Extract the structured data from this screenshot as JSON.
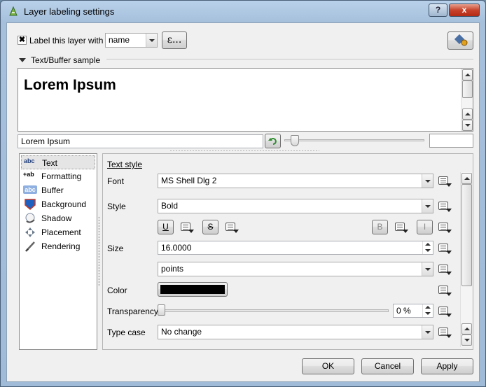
{
  "window": {
    "title": "Layer labeling settings",
    "help": "?",
    "close": "x"
  },
  "top": {
    "label_checkbox": "Label this layer with",
    "checked": "✖",
    "field_value": "name",
    "expr_button": "ε..."
  },
  "sample": {
    "header": "Text/Buffer sample",
    "preview_text": "Lorem Ipsum",
    "input_value": "Lorem Ipsum"
  },
  "sidebar": {
    "items": [
      {
        "label": "Text",
        "icon": "abc"
      },
      {
        "label": "Formatting",
        "icon": "+ab"
      },
      {
        "label": "Buffer",
        "icon": "abc"
      },
      {
        "label": "Background",
        "icon": "background-icon"
      },
      {
        "label": "Shadow",
        "icon": "shadow-icon"
      },
      {
        "label": "Placement",
        "icon": "placement-icon"
      },
      {
        "label": "Rendering",
        "icon": "rendering-icon"
      }
    ]
  },
  "text_style": {
    "header": "Text style",
    "font_label": "Font",
    "font_value": "MS Shell Dlg 2",
    "style_label": "Style",
    "style_value": "Bold",
    "underline": "U",
    "strike": "S",
    "bold": "B",
    "italic": "I",
    "size_label": "Size",
    "size_value": "16.0000",
    "unit_value": "points",
    "color_label": "Color",
    "color_value": "#000000",
    "transparency_label": "Transparency",
    "transparency_value": "0 %",
    "typecase_label": "Type case",
    "typecase_value": "No change"
  },
  "buttons": {
    "ok": "OK",
    "cancel": "Cancel",
    "apply": "Apply"
  }
}
